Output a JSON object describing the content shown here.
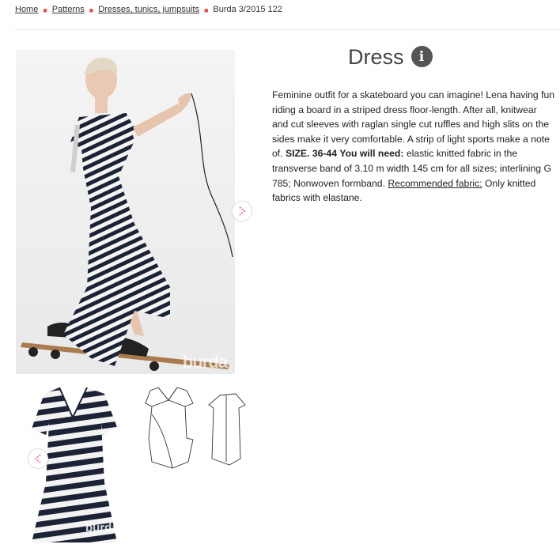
{
  "breadcrumb": {
    "items": [
      "Home",
      "Patterns",
      "Dresses, tunics, jumpsuits"
    ],
    "current": "Burda 3/2015 122"
  },
  "product": {
    "title": "Dress",
    "description_intro": "Feminine outfit for a skateboard you can imagine! Lena having fun riding a board in a striped dress floor-length. After all, knitwear and cut sleeves with raglan single cut ruffles and high slits on the sides make it very comfortable. A strip of light sports make a note of.",
    "size_label": "SIZE. 36-44",
    "need_label": "You will need:",
    "need_text": "elastic knitted fabric in the transverse band of 3.10 m width 145 cm for all sizes; interlining G 785; Nonwoven formband.",
    "fabric_link": "Recommended fabric:",
    "fabric_text": "Only knitted fabrics with elastane."
  },
  "gallery": {
    "watermark": "burda",
    "thumb_watermark": "burda"
  },
  "icons": {
    "info": "info-icon",
    "next": "chevron-right-icon",
    "prev": "chevron-left-icon"
  },
  "colors": {
    "breadcrumb_separator": "#d9534f",
    "arrow": "#e58aa6",
    "info_badge": "#555555",
    "stripe_dark": "#1c2336"
  }
}
